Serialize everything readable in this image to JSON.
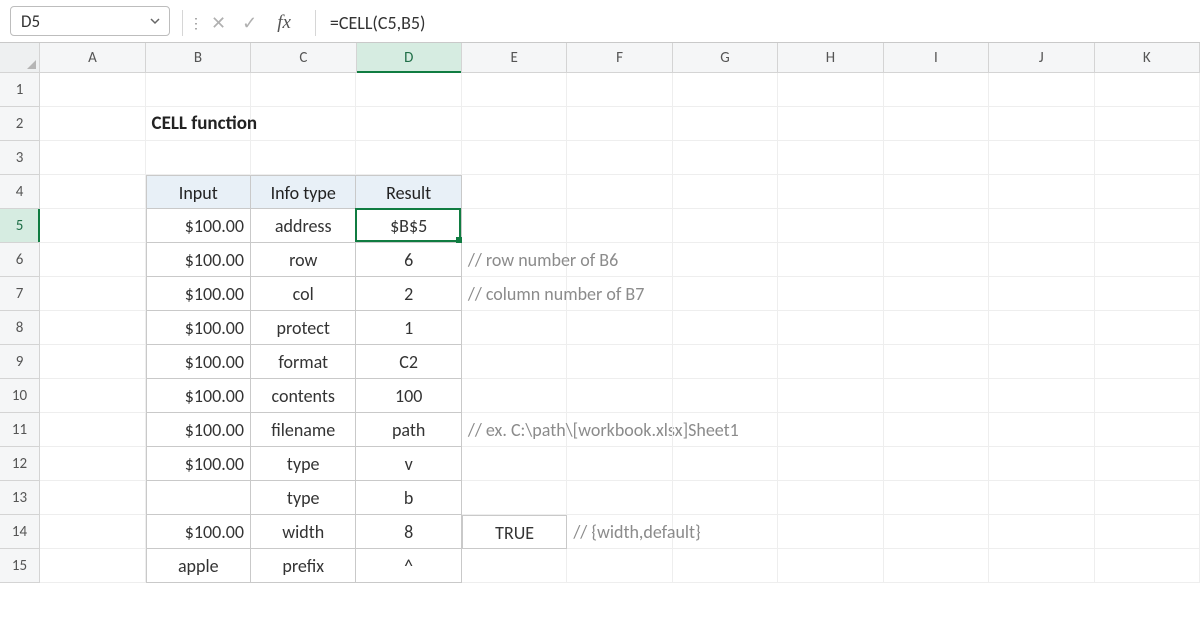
{
  "namebox": {
    "value": "D5"
  },
  "formula_bar": {
    "formula": "=CELL(C5,B5)",
    "fx_label": "fx"
  },
  "columns": [
    "A",
    "B",
    "C",
    "D",
    "E",
    "F",
    "G",
    "H",
    "I",
    "J",
    "K"
  ],
  "row_numbers": [
    "1",
    "2",
    "3",
    "4",
    "5",
    "6",
    "7",
    "8",
    "9",
    "10",
    "11",
    "12",
    "13",
    "14",
    "15"
  ],
  "active_col_index": 3,
  "active_row_index": 4,
  "title": "CELL function",
  "table": {
    "headers": {
      "input": "Input",
      "info_type": "Info type",
      "result": "Result"
    },
    "rows": [
      {
        "input": "$100.00",
        "info": "address",
        "result": "$B$5",
        "comment": ""
      },
      {
        "input": "$100.00",
        "info": "row",
        "result": "6",
        "comment": "// row number of B6"
      },
      {
        "input": "$100.00",
        "info": "col",
        "result": "2",
        "comment": "// column number of B7"
      },
      {
        "input": "$100.00",
        "info": "protect",
        "result": "1",
        "comment": ""
      },
      {
        "input": "$100.00",
        "info": "format",
        "result": "C2",
        "comment": ""
      },
      {
        "input": "$100.00",
        "info": "contents",
        "result": "100",
        "comment": ""
      },
      {
        "input": "$100.00",
        "info": "filename",
        "result": "path",
        "comment": "// ex. C:\\path\\[workbook.xlsx]Sheet1"
      },
      {
        "input": "$100.00",
        "info": "type",
        "result": "v",
        "comment": ""
      },
      {
        "input": "",
        "info": "type",
        "result": "b",
        "comment": ""
      },
      {
        "input": "$100.00",
        "info": "width",
        "result": "8",
        "extra": "TRUE",
        "comment": "// {width,default}"
      },
      {
        "input": "apple",
        "info": "prefix",
        "result": "^",
        "comment": ""
      }
    ]
  }
}
